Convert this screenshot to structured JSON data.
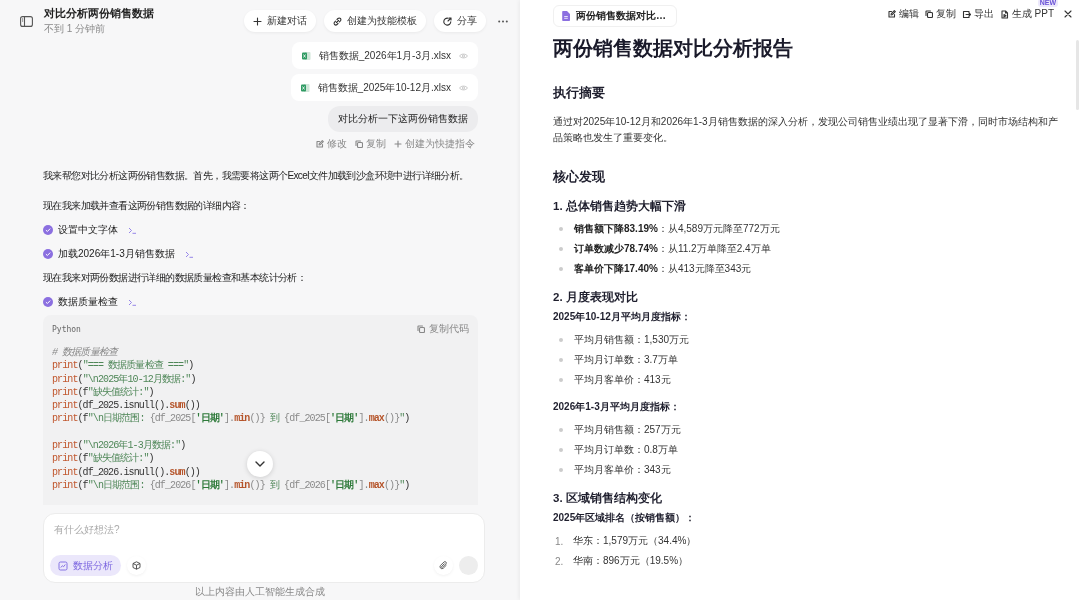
{
  "chat": {
    "header": {
      "title": "对比分析两份销售数据",
      "subtitle": "不到 1 分钟前",
      "buttons": [
        {
          "kind": "new",
          "label": "新建对话"
        },
        {
          "kind": "template",
          "label": "创建为技能模板"
        },
        {
          "kind": "share",
          "label": "分享"
        }
      ]
    },
    "attachments": [
      {
        "name": "销售数据_2026年1月-3月.xlsx"
      },
      {
        "name": "销售数据_2025年10-12月.xlsx"
      }
    ],
    "user_message": {
      "text": "对比分析一下这两份销售数据",
      "actions": [
        {
          "kind": "edit",
          "label": "修改"
        },
        {
          "kind": "copy",
          "label": "复制"
        },
        {
          "kind": "shortcut",
          "label": "创建为快捷指令"
        }
      ]
    },
    "blocks": [
      {
        "kind": "text",
        "text": "我来帮您对比分析这两份销售数据。首先，我需要将这两个Excel文件加载到沙盒环境中进行详细分析。"
      },
      {
        "kind": "text",
        "text": "现在我来加载并查看这两份销售数据的详细内容："
      },
      {
        "kind": "step",
        "label": "设置中文字体",
        "done": true
      },
      {
        "kind": "step",
        "label": "加载2026年1-3月销售数据",
        "done": true
      },
      {
        "kind": "text",
        "text": "现在我来对两份数据进行详细的数据质量检查和基本统计分析："
      },
      {
        "kind": "step",
        "label": "数据质量检查",
        "done": true
      },
      {
        "kind": "code",
        "language": "Python",
        "copy_label": "复制代码",
        "lines": [
          {
            "tokens": [
              {
                "kind": "comment",
                "text": "# 数据质量检查"
              }
            ]
          },
          {
            "tokens": [
              {
                "kind": "fn",
                "text": "print"
              },
              {
                "kind": "plain",
                "text": "("
              },
              {
                "kind": "str",
                "text": "\"=== 数据质量检查 ===\""
              },
              {
                "kind": "plain",
                "text": ")"
              }
            ]
          },
          {
            "tokens": [
              {
                "kind": "fn",
                "text": "print"
              },
              {
                "kind": "plain",
                "text": "("
              },
              {
                "kind": "str",
                "text": "\"\\n2025年10-12月数据:\""
              },
              {
                "kind": "plain",
                "text": ")"
              }
            ]
          },
          {
            "tokens": [
              {
                "kind": "fn",
                "text": "print"
              },
              {
                "kind": "plain",
                "text": "(f"
              },
              {
                "kind": "str",
                "text": "\"缺失值统计:\""
              },
              {
                "kind": "plain",
                "text": ")"
              }
            ]
          },
          {
            "tokens": [
              {
                "kind": "fn",
                "text": "print"
              },
              {
                "kind": "plain",
                "text": "(df_2025.isnull()."
              },
              {
                "kind": "method",
                "text": "sum"
              },
              {
                "kind": "plain",
                "text": "())"
              }
            ]
          },
          {
            "tokens": [
              {
                "kind": "fn",
                "text": "print"
              },
              {
                "kind": "plain",
                "text": "(f"
              },
              {
                "kind": "str",
                "text": "\"\\n日期范围: "
              },
              {
                "kind": "interp",
                "text": "{df_2025["
              },
              {
                "kind": "key",
                "text": "'日期'"
              },
              {
                "kind": "interp",
                "text": "]."
              },
              {
                "kind": "method",
                "text": "min"
              },
              {
                "kind": "interp",
                "text": "()}"
              },
              {
                "kind": "str",
                "text": " 到 "
              },
              {
                "kind": "interp",
                "text": "{df_2025["
              },
              {
                "kind": "key",
                "text": "'日期'"
              },
              {
                "kind": "interp",
                "text": "]."
              },
              {
                "kind": "method",
                "text": "max"
              },
              {
                "kind": "interp",
                "text": "()}"
              },
              {
                "kind": "str",
                "text": "\""
              },
              {
                "kind": "plain",
                "text": ")"
              }
            ]
          },
          {
            "kind": "blank"
          },
          {
            "tokens": [
              {
                "kind": "fn",
                "text": "print"
              },
              {
                "kind": "plain",
                "text": "("
              },
              {
                "kind": "str",
                "text": "\"\\n2026年1-3月数据:\""
              },
              {
                "kind": "plain",
                "text": ")"
              }
            ]
          },
          {
            "tokens": [
              {
                "kind": "fn",
                "text": "print"
              },
              {
                "kind": "plain",
                "text": "(f"
              },
              {
                "kind": "str",
                "text": "\"缺失值统计:\""
              },
              {
                "kind": "plain",
                "text": ")"
              }
            ]
          },
          {
            "tokens": [
              {
                "kind": "fn",
                "text": "print"
              },
              {
                "kind": "plain",
                "text": "(df_2026.isnull()."
              },
              {
                "kind": "method",
                "text": "sum"
              },
              {
                "kind": "plain",
                "text": "())"
              }
            ]
          },
          {
            "tokens": [
              {
                "kind": "fn",
                "text": "print"
              },
              {
                "kind": "plain",
                "text": "(f"
              },
              {
                "kind": "str",
                "text": "\"\\n日期范围: "
              },
              {
                "kind": "interp",
                "text": "{df_2026["
              },
              {
                "kind": "key",
                "text": "'日期'"
              },
              {
                "kind": "interp",
                "text": "]."
              },
              {
                "kind": "method",
                "text": "min"
              },
              {
                "kind": "interp",
                "text": "()}"
              },
              {
                "kind": "str",
                "text": " 到 "
              },
              {
                "kind": "interp",
                "text": "{df_2026["
              },
              {
                "kind": "key",
                "text": "'日期'"
              },
              {
                "kind": "interp",
                "text": "]."
              },
              {
                "kind": "method",
                "text": "max"
              },
              {
                "kind": "interp",
                "text": "()}"
              },
              {
                "kind": "str",
                "text": "\""
              },
              {
                "kind": "plain",
                "text": ")"
              }
            ]
          }
        ]
      }
    ],
    "composer": {
      "placeholder": "有什么好想法?",
      "mode": {
        "label": "数据分析",
        "selected": true
      },
      "send_disabled": true
    },
    "footer": "以上内容由人工智能生成合成"
  },
  "document": {
    "tab": {
      "title": "两份销售数据对比…"
    },
    "toolbar": [
      {
        "kind": "edit",
        "label": "编辑"
      },
      {
        "kind": "copy",
        "label": "复制"
      },
      {
        "kind": "export",
        "label": "导出"
      },
      {
        "kind": "ppt",
        "label": "生成 PPT",
        "badge": "NEW"
      }
    ],
    "blocks": [
      {
        "kind": "h1",
        "text": "两份销售数据对比分析报告"
      },
      {
        "kind": "h2",
        "text": "执行摘要"
      },
      {
        "kind": "p",
        "text": "通过对2025年10-12月和2026年1-3月销售数据的深入分析，发现公司销售业绩出现了显著下滑，同时市场结构和产品策略也发生了重要变化。"
      },
      {
        "kind": "h2",
        "text": "核心发现"
      },
      {
        "kind": "h3",
        "text": "1. 总体销售趋势大幅下滑"
      },
      {
        "kind": "ul",
        "items": [
          "**销售额下降83.19%**：从4,589万元降至772万元",
          "**订单数减少78.74%**：从11.2万单降至2.4万单",
          "**客单价下降17.40%**：从413元降至343元"
        ]
      },
      {
        "kind": "h3",
        "text": "2. 月度表现对比"
      },
      {
        "kind": "label",
        "text": "2025年10-12月平均月度指标："
      },
      {
        "kind": "ul",
        "items": [
          "平均月销售额：1,530万元",
          "平均月订单数：3.7万单",
          "平均月客单价：413元"
        ]
      },
      {
        "kind": "label",
        "text": "2026年1-3月平均月度指标："
      },
      {
        "kind": "ul",
        "items": [
          "平均月销售额：257万元",
          "平均月订单数：0.8万单",
          "平均月客单价：343元"
        ]
      },
      {
        "kind": "h3",
        "text": "3. 区域销售结构变化"
      },
      {
        "kind": "label",
        "text": "2025年区域排名（按销售额）："
      },
      {
        "kind": "ol",
        "items": [
          {
            "number": "1.",
            "text": "华东：1,579万元（34.4%）"
          },
          {
            "number": "2.",
            "text": "华南：896万元（19.5%）"
          }
        ]
      }
    ]
  }
}
